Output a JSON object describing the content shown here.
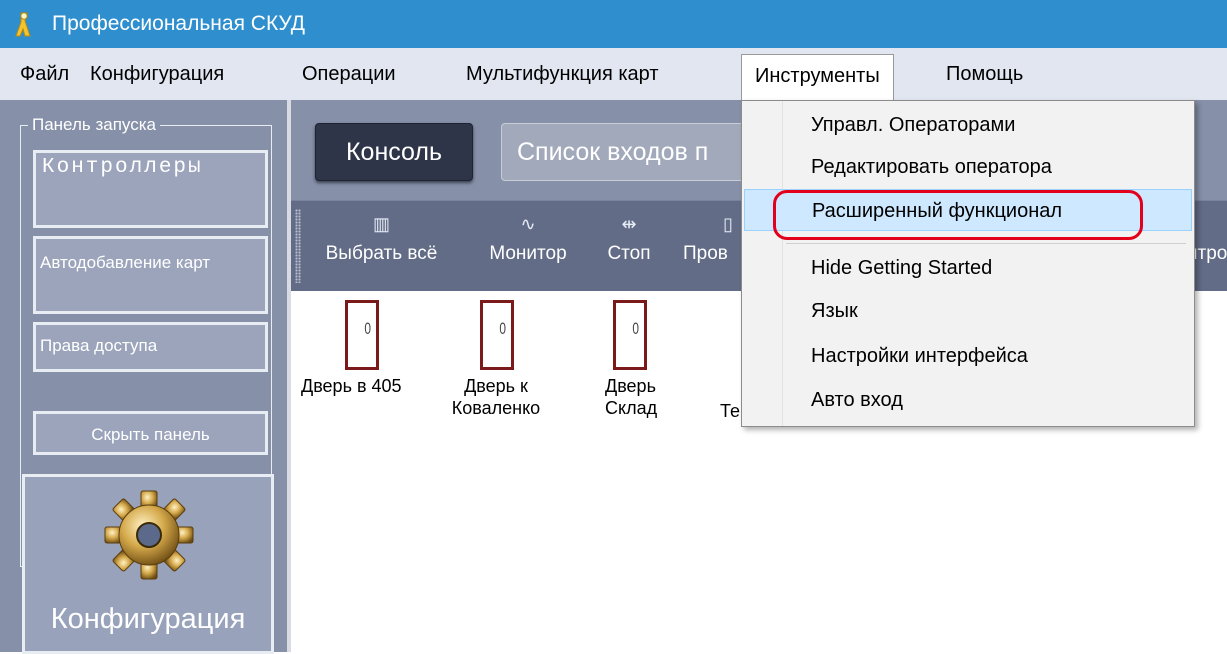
{
  "window": {
    "title": "Профессиональная СКУД"
  },
  "menubar": {
    "items": [
      {
        "label": "Файл"
      },
      {
        "label": "Конфигурация"
      },
      {
        "label": "Операции"
      },
      {
        "label": "Мультифункция карт"
      },
      {
        "label": "Инструменты",
        "open": true
      },
      {
        "label": "Помощь"
      }
    ]
  },
  "launch_panel": {
    "caption": "Панель запуска",
    "buttons": {
      "controllers": "Контроллеры",
      "autoadd": "Автодобавление карт",
      "rights": "Права доступа",
      "hide": "Скрыть панель"
    },
    "config_label": "Конфигурация"
  },
  "tabs": {
    "console": "Консоль",
    "entries": "Список входов п"
  },
  "toolbar": {
    "select_all": "Выбрать всё",
    "monitor": "Монитор",
    "stop": "Стоп",
    "check": "Пров",
    "right_cut": "нтро"
  },
  "doors": [
    {
      "number": "0",
      "name": "Дверь в 405"
    },
    {
      "number": "0",
      "name": "Дверь к Коваленко"
    },
    {
      "number": "0",
      "name": "Дверь Склад"
    },
    {
      "number": "",
      "name": "Те"
    }
  ],
  "dropdown": {
    "items": [
      {
        "label": "Управл. Операторами"
      },
      {
        "label": "Редактировать оператора"
      },
      {
        "label": "Расширенный функционал",
        "highlighted": true
      },
      {
        "label": "Hide Getting Started"
      },
      {
        "label": "Язык"
      },
      {
        "label": "Настройки интерфейса"
      },
      {
        "label": "Авто вход"
      }
    ]
  },
  "colors": {
    "titlebar": "#2f8fce",
    "menubar": "#e1e6f0",
    "panel": "#8690a8",
    "toolbar": "#626c86",
    "highlight": "#cde8ff",
    "annotation": "#e3001b",
    "door_frame": "#7b1a1a"
  },
  "icons": [
    "key-icon",
    "gear-icon",
    "select-all-icon",
    "monitor-icon",
    "stop-icon",
    "check-icon"
  ]
}
